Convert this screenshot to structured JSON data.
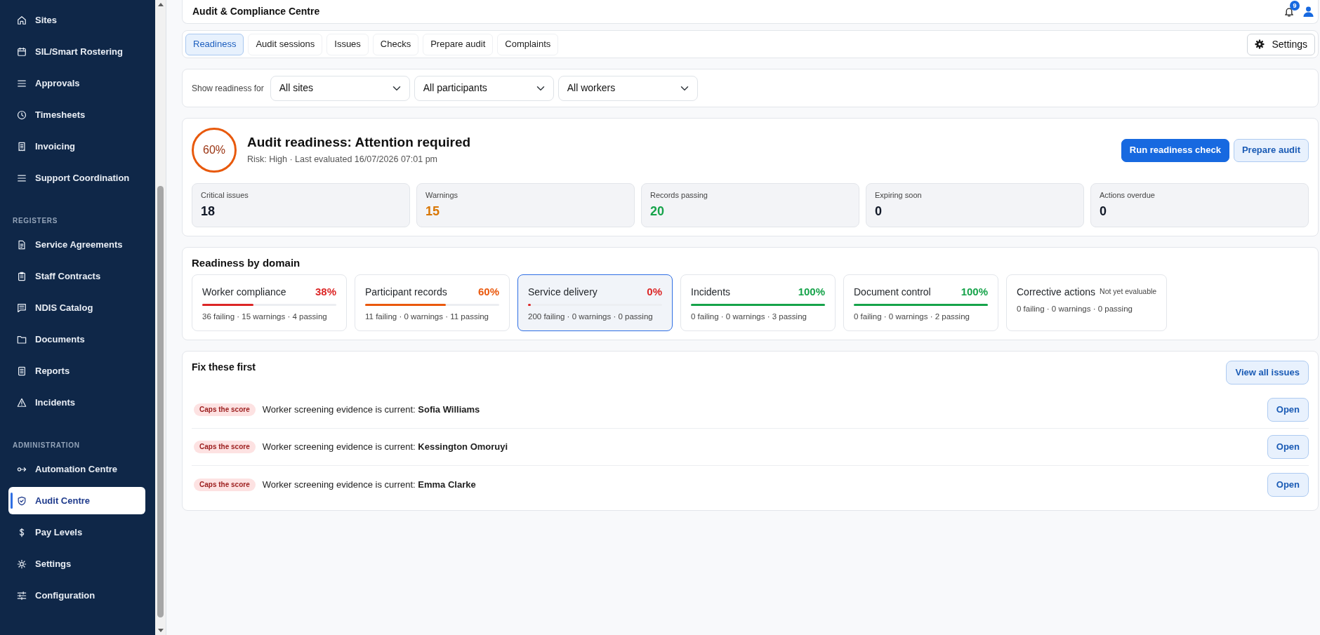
{
  "sidebar": {
    "sections": [
      {
        "items": [
          {
            "label": "Sites",
            "selected": false
          },
          {
            "label": "SIL/Smart Rostering",
            "selected": false
          },
          {
            "label": "Approvals",
            "selected": false
          },
          {
            "label": "Timesheets",
            "selected": false
          },
          {
            "label": "Invoicing",
            "selected": false
          },
          {
            "label": "Support Coordination",
            "selected": false
          }
        ]
      },
      {
        "heading": "REGISTERS",
        "items": [
          {
            "label": "Service Agreements",
            "selected": false
          },
          {
            "label": "Staff Contracts",
            "selected": false
          },
          {
            "label": "NDIS Catalog",
            "selected": false
          },
          {
            "label": "Documents",
            "selected": false
          },
          {
            "label": "Reports",
            "selected": false
          },
          {
            "label": "Incidents",
            "selected": false
          }
        ]
      },
      {
        "heading": "ADMINISTRATION",
        "items": [
          {
            "label": "Automation Centre",
            "selected": false
          },
          {
            "label": "Audit Centre",
            "selected": true
          },
          {
            "label": "Pay Levels",
            "selected": false
          },
          {
            "label": "Settings",
            "selected": false
          },
          {
            "label": "Configuration",
            "selected": false
          }
        ]
      }
    ]
  },
  "header": {
    "title": "Audit & Compliance Centre",
    "notification_count": "9"
  },
  "tabs": [
    {
      "label": "Readiness",
      "selected": true
    },
    {
      "label": "Audit sessions",
      "selected": false
    },
    {
      "label": "Issues",
      "selected": false
    },
    {
      "label": "Checks",
      "selected": false
    },
    {
      "label": "Prepare audit",
      "selected": false
    },
    {
      "label": "Complaints",
      "selected": false
    }
  ],
  "settings_button": {
    "label": "Settings"
  },
  "filters": {
    "label": "Show readiness for",
    "selects": [
      {
        "value": "All sites"
      },
      {
        "value": "All participants"
      },
      {
        "value": "All workers"
      }
    ]
  },
  "readiness": {
    "score": "60%",
    "title": "Audit readiness: Attention required",
    "subtitle": "Risk: High · Last evaluated 16/07/2026 07:01 pm",
    "buttons": [
      {
        "label": "Run readiness check",
        "kind": "primary"
      },
      {
        "label": "Prepare audit",
        "kind": "secondary"
      }
    ],
    "stats": [
      {
        "label": "Critical issues",
        "value": "18",
        "color": "#111827"
      },
      {
        "label": "Warnings",
        "value": "15",
        "color": "#d97706"
      },
      {
        "label": "Records passing",
        "value": "20",
        "color": "#16a34a"
      },
      {
        "label": "Expiring soon",
        "value": "0",
        "color": "#111827"
      },
      {
        "label": "Actions overdue",
        "value": "0",
        "color": "#111827"
      }
    ]
  },
  "domains": {
    "title": "Readiness by domain",
    "items": [
      {
        "kind": "scored",
        "name": "Worker compliance",
        "percent": "38%",
        "level": 0.38,
        "color": "#dc2626",
        "summary": "36 failing · 15 warnings · 4 passing",
        "selected": false
      },
      {
        "kind": "scored",
        "name": "Participant records",
        "percent": "60%",
        "level": 0.6,
        "color": "#ea580c",
        "summary": "11 failing · 0 warnings · 11 passing",
        "selected": false
      },
      {
        "kind": "scored",
        "name": "Service delivery",
        "percent": "0%",
        "level": 0,
        "color": "#dc2626",
        "summary": "200 failing · 0 warnings · 0 passing",
        "selected": true
      },
      {
        "kind": "scored",
        "name": "Incidents",
        "percent": "100%",
        "level": 1,
        "color": "#16a34a",
        "summary": "0 failing · 0 warnings · 3 passing",
        "selected": false
      },
      {
        "kind": "scored",
        "name": "Document control",
        "percent": "100%",
        "level": 1,
        "color": "#16a34a",
        "summary": "0 failing · 0 warnings · 2 passing",
        "selected": false
      },
      {
        "kind": "unevaluated",
        "name": "Corrective actions",
        "note": "Not yet evaluable",
        "summary": "0 failing · 0 warnings · 0 passing",
        "selected": false
      }
    ]
  },
  "fix_first": {
    "title": "Fix these first",
    "button": "View all issues",
    "items": [
      {
        "badge": "Caps the score",
        "text": "Worker screening evidence is current: **Sofia Williams**",
        "action": "Open"
      },
      {
        "badge": "Caps the score",
        "text": "Worker screening evidence is current: **Kessington Omoruyi**",
        "action": "Open"
      },
      {
        "badge": "Caps the score",
        "text": "Worker screening evidence is current: **Emma Clarke**",
        "action": "Open"
      }
    ]
  }
}
